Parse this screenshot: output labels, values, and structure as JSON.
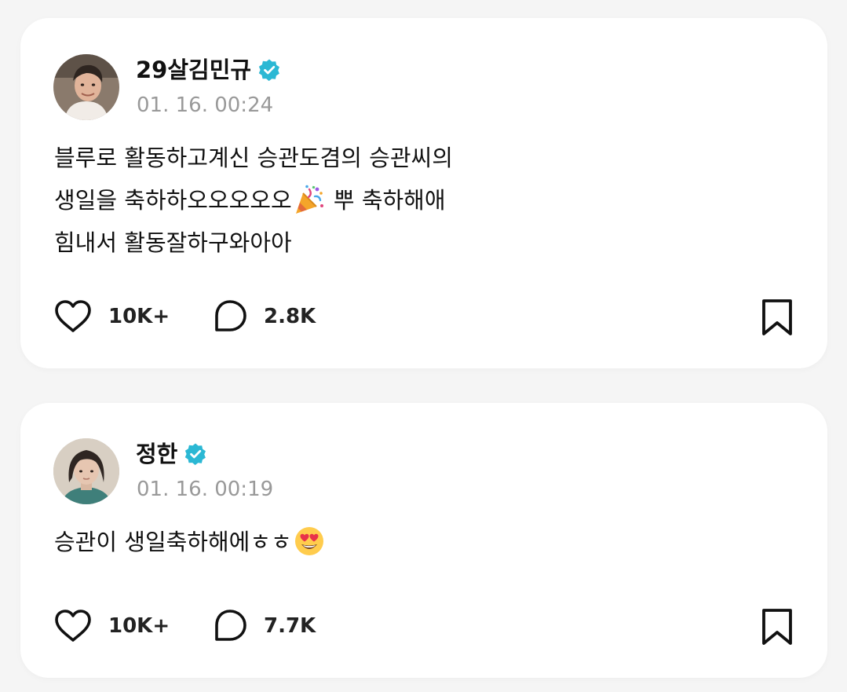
{
  "colors": {
    "background": "#f5f5f5",
    "card": "#ffffff",
    "verified_badge": "#2bb8d4",
    "timestamp": "#999999",
    "text": "#111111"
  },
  "posts": [
    {
      "author": "29살김민규",
      "verified": true,
      "verified_icon": "verified-badge-icon",
      "timestamp": "01. 16. 00:24",
      "body_lines": [
        {
          "text": "블루로 활동하고계신 승관도겸의 승관씨의"
        },
        {
          "before": "생일을 축하하오오오오오",
          "emoji": "party-popper-icon",
          "after": " 뿌 축하해애"
        },
        {
          "text": "힘내서 활동잘하구와아아"
        }
      ],
      "likes": "10K+",
      "comments": "2.8K",
      "like_icon": "heart-icon",
      "comment_icon": "comment-bubble-icon",
      "bookmark_icon": "bookmark-icon"
    },
    {
      "author": "정한",
      "verified": true,
      "verified_icon": "verified-badge-icon",
      "timestamp": "01. 16. 00:19",
      "body_lines": [
        {
          "before": "승관이 생일축하해에ㅎㅎ",
          "emoji": "heart-eyes-emoji-icon",
          "after": ""
        }
      ],
      "likes": "10K+",
      "comments": "7.7K",
      "like_icon": "heart-icon",
      "comment_icon": "comment-bubble-icon",
      "bookmark_icon": "bookmark-icon"
    }
  ]
}
